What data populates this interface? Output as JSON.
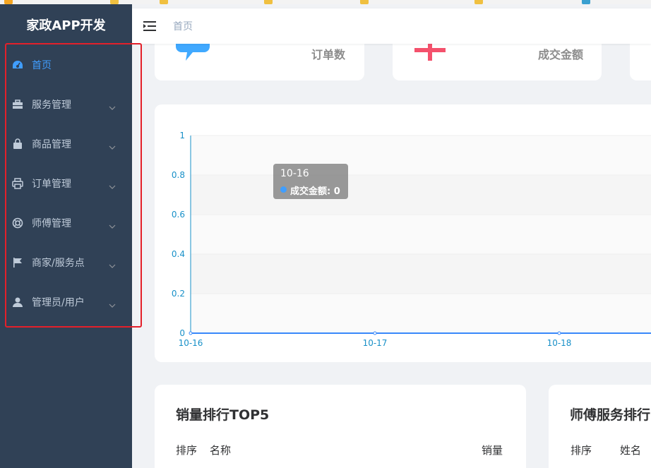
{
  "app": {
    "title": "家政APP开发"
  },
  "navbar": {
    "breadcrumb": "首页"
  },
  "sidebar": {
    "items": [
      {
        "label": "首页",
        "icon": "dashboard-icon",
        "active": true
      },
      {
        "label": "服务管理",
        "icon": "briefcase-icon"
      },
      {
        "label": "商品管理",
        "icon": "shopping-bag-icon"
      },
      {
        "label": "订单管理",
        "icon": "printer-icon"
      },
      {
        "label": "师傅管理",
        "icon": "lifebuoy-icon"
      },
      {
        "label": "商家/服务点",
        "icon": "flag-icon"
      },
      {
        "label": "管理员/用户",
        "icon": "user-icon"
      }
    ]
  },
  "stats": [
    {
      "label": "订单数",
      "icon": "message-icon",
      "color": "#40a9ff"
    },
    {
      "label": "成交金额",
      "icon": "yen-icon",
      "color": "#f4516c"
    }
  ],
  "chart_data": {
    "type": "line",
    "categories": [
      "10-16",
      "10-17",
      "10-18"
    ],
    "series": [
      {
        "name": "成交金额",
        "values": [
          0,
          0,
          0
        ]
      }
    ],
    "ylim": [
      0,
      1
    ],
    "yticks": [
      "0",
      "0.2",
      "0.4",
      "0.6",
      "0.8",
      "1"
    ],
    "tooltip": {
      "title": "10-16",
      "series": "成交金额",
      "value": "0"
    },
    "colors": {
      "line": "#3888fa",
      "axis": "#1890c8"
    }
  },
  "ranking": {
    "title": "销量排行TOP5",
    "columns": [
      "排序",
      "名称",
      "销量"
    ]
  },
  "masters": {
    "title": "师傅服务排行",
    "columns": [
      "排序",
      "姓名"
    ]
  }
}
